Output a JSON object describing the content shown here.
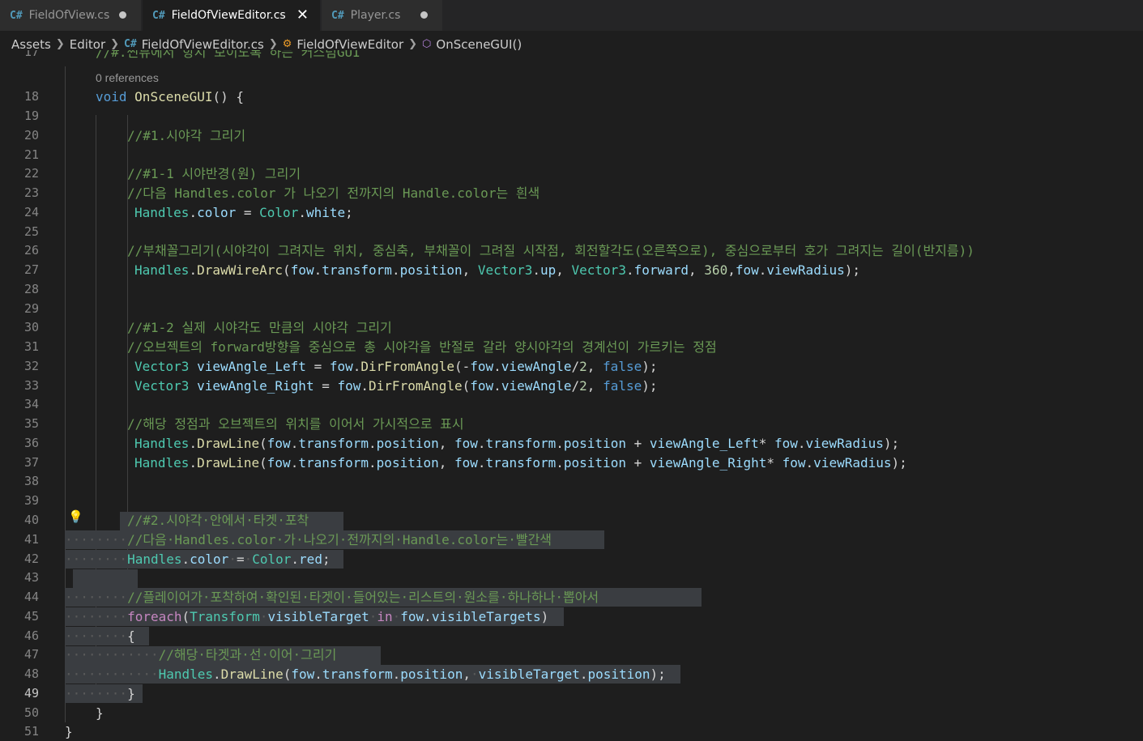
{
  "tabs": [
    {
      "label": "FieldOfView.cs",
      "state": "modified"
    },
    {
      "label": "FieldOfViewEditor.cs",
      "state": "active"
    },
    {
      "label": "Player.cs",
      "state": "modified"
    }
  ],
  "breadcrumb": {
    "items": [
      "Assets",
      "Editor",
      "FieldOfViewEditor.cs",
      "FieldOfViewEditor",
      "OnSceneGUI()"
    ],
    "icons": [
      "none",
      "none",
      "csharp-file-icon",
      "class-icon",
      "method-icon"
    ]
  },
  "codelens": "0 references",
  "colors": {
    "comment": "#6a9955",
    "keyword": "#569cd6",
    "type": "#4ec9b0",
    "function": "#dcdcaa",
    "variable": "#9cdcfe",
    "number": "#b5cea8",
    "control": "#c586c0",
    "selection": "#3a3d41"
  },
  "lines": [
    {
      "n": "17",
      "text": "//#.씬뷰에서 항시 보이도록 하는 커스텀GUI"
    },
    {
      "n": "18",
      "text": "void OnSceneGUI() {"
    },
    {
      "n": "19",
      "text": ""
    },
    {
      "n": "20",
      "text": "//#1.시야각 그리기"
    },
    {
      "n": "21",
      "text": ""
    },
    {
      "n": "22",
      "text": "//#1-1 시야반경(원) 그리기"
    },
    {
      "n": "23",
      "text": "//다음 Handles.color 가 나오기 전까지의 Handle.color는 흰색"
    },
    {
      "n": "24",
      "text": "Handles.color = Color.white;"
    },
    {
      "n": "25",
      "text": ""
    },
    {
      "n": "26",
      "text": "//부채꼴그리기(시야각이 그려지는 위치, 중심축, 부채꼴이 그려질 시작점, 회전할각도(오른쪽으로), 중심으로부터 호가 그려지는 길이(반지름))"
    },
    {
      "n": "27",
      "text": "Handles.DrawWireArc(fow.transform.position, Vector3.up, Vector3.forward, 360,fow.viewRadius);"
    },
    {
      "n": "28",
      "text": ""
    },
    {
      "n": "29",
      "text": ""
    },
    {
      "n": "30",
      "text": "//#1-2 실제 시야각도 만큼의 시야각 그리기"
    },
    {
      "n": "31",
      "text": "//오브젝트의 forward방향을 중심으로 총 시야각을 반절로 갈라 양시야각의 경계선이 가르키는 정점"
    },
    {
      "n": "32",
      "text": "Vector3 viewAngle_Left = fow.DirFromAngle(-fow.viewAngle/2, false);"
    },
    {
      "n": "33",
      "text": "Vector3 viewAngle_Right = fow.DirFromAngle(fow.viewAngle/2, false);"
    },
    {
      "n": "34",
      "text": ""
    },
    {
      "n": "35",
      "text": "//해당 정점과 오브젝트의 위치를 이어서 가시적으로 표시"
    },
    {
      "n": "36",
      "text": "Handles.DrawLine(fow.transform.position, fow.transform.position + viewAngle_Left* fow.viewRadius);"
    },
    {
      "n": "37",
      "text": "Handles.DrawLine(fow.transform.position, fow.transform.position + viewAngle_Right* fow.viewRadius);"
    },
    {
      "n": "38",
      "text": ""
    },
    {
      "n": "39",
      "text": ""
    },
    {
      "n": "40",
      "text": "//#2.시야각·안에서·타겟·포착"
    },
    {
      "n": "41",
      "text": "//다음·Handles.color·가·나오기·전까지의·Handle.color는·빨간색"
    },
    {
      "n": "42",
      "text": "Handles.color·=·Color.red;"
    },
    {
      "n": "43",
      "text": ""
    },
    {
      "n": "44",
      "text": "//플레이어가·포착하여·확인된·타겟이·들어있는·리스트의·원소를·하나하나·뽑아서"
    },
    {
      "n": "45",
      "text": "foreach(Transform·visibleTarget·in·fow.visibleTargets)"
    },
    {
      "n": "46",
      "text": "{"
    },
    {
      "n": "47",
      "text": "//해당·타겟과·선·이어·그리기"
    },
    {
      "n": "48",
      "text": "Handles.DrawLine(fow.transform.position,·visibleTarget.position);"
    },
    {
      "n": "49",
      "text": "}"
    },
    {
      "n": "50",
      "text": "}"
    },
    {
      "n": "51",
      "text": "}"
    }
  ]
}
